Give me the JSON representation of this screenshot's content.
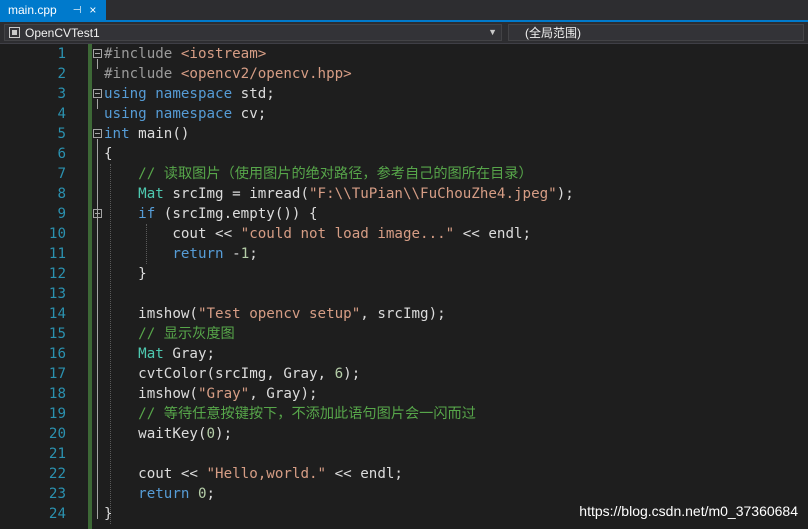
{
  "tab": {
    "label": "main.cpp",
    "pin": "⊣",
    "close": "×"
  },
  "navbar": {
    "project": "OpenCVTest1",
    "scope": "(全局范围)"
  },
  "code_lines": [
    {
      "n": "1",
      "segs": [
        [
          "pp",
          "#include "
        ],
        [
          "inc",
          "<iostream>"
        ]
      ]
    },
    {
      "n": "2",
      "segs": [
        [
          "pp",
          "#include "
        ],
        [
          "inc",
          "<opencv2/opencv.hpp>"
        ]
      ]
    },
    {
      "n": "3",
      "segs": [
        [
          "kw",
          "using namespace "
        ],
        [
          "plain",
          "std;"
        ]
      ]
    },
    {
      "n": "4",
      "segs": [
        [
          "kw",
          "using namespace "
        ],
        [
          "plain",
          "cv;"
        ]
      ]
    },
    {
      "n": "5",
      "segs": [
        [
          "kw",
          "int "
        ],
        [
          "plain",
          "main()"
        ]
      ]
    },
    {
      "n": "6",
      "segs": [
        [
          "plain",
          "{"
        ]
      ]
    },
    {
      "n": "7",
      "segs": [
        [
          "plain",
          "    "
        ],
        [
          "cm",
          "// 读取图片（使用图片的绝对路径，参考自己的图所在目录）"
        ]
      ]
    },
    {
      "n": "8",
      "segs": [
        [
          "plain",
          "    "
        ],
        [
          "ty",
          "Mat"
        ],
        [
          "plain",
          " srcImg = imread("
        ],
        [
          "str",
          "\"F:\\\\TuPian\\\\FuChouZhe4.jpeg\""
        ],
        [
          "plain",
          ");"
        ]
      ]
    },
    {
      "n": "9",
      "segs": [
        [
          "plain",
          "    "
        ],
        [
          "kw",
          "if"
        ],
        [
          "plain",
          " (srcImg.empty()) {"
        ]
      ]
    },
    {
      "n": "10",
      "segs": [
        [
          "plain",
          "        cout << "
        ],
        [
          "str",
          "\"could not load image...\""
        ],
        [
          "plain",
          " << endl;"
        ]
      ]
    },
    {
      "n": "11",
      "segs": [
        [
          "plain",
          "        "
        ],
        [
          "kw",
          "return"
        ],
        [
          "plain",
          " -"
        ],
        [
          "num",
          "1"
        ],
        [
          "plain",
          ";"
        ]
      ]
    },
    {
      "n": "12",
      "segs": [
        [
          "plain",
          "    }"
        ]
      ]
    },
    {
      "n": "13",
      "segs": [
        [
          "plain",
          ""
        ]
      ]
    },
    {
      "n": "14",
      "segs": [
        [
          "plain",
          "    imshow("
        ],
        [
          "str",
          "\"Test opencv setup\""
        ],
        [
          "plain",
          ", srcImg);"
        ]
      ]
    },
    {
      "n": "15",
      "segs": [
        [
          "plain",
          "    "
        ],
        [
          "cm",
          "// 显示灰度图"
        ]
      ]
    },
    {
      "n": "16",
      "segs": [
        [
          "plain",
          "    "
        ],
        [
          "ty",
          "Mat"
        ],
        [
          "plain",
          " Gray;"
        ]
      ]
    },
    {
      "n": "17",
      "segs": [
        [
          "plain",
          "    cvtColor(srcImg, Gray, "
        ],
        [
          "num",
          "6"
        ],
        [
          "plain",
          ");"
        ]
      ]
    },
    {
      "n": "18",
      "segs": [
        [
          "plain",
          "    imshow("
        ],
        [
          "str",
          "\"Gray\""
        ],
        [
          "plain",
          ", Gray);"
        ]
      ]
    },
    {
      "n": "19",
      "segs": [
        [
          "plain",
          "    "
        ],
        [
          "cm",
          "// 等待任意按键按下，不添加此语句图片会一闪而过"
        ]
      ]
    },
    {
      "n": "20",
      "segs": [
        [
          "plain",
          "    waitKey("
        ],
        [
          "num",
          "0"
        ],
        [
          "plain",
          ");"
        ]
      ]
    },
    {
      "n": "21",
      "segs": [
        [
          "plain",
          ""
        ]
      ]
    },
    {
      "n": "22",
      "segs": [
        [
          "plain",
          "    cout << "
        ],
        [
          "str",
          "\"Hello,world.\""
        ],
        [
          "plain",
          " << endl;"
        ]
      ]
    },
    {
      "n": "23",
      "segs": [
        [
          "plain",
          "    "
        ],
        [
          "kw",
          "return"
        ],
        [
          "plain",
          " "
        ],
        [
          "num",
          "0"
        ],
        [
          "plain",
          ";"
        ]
      ]
    },
    {
      "n": "24",
      "segs": [
        [
          "plain",
          "}"
        ]
      ]
    }
  ],
  "watermark": "https://blog.csdn.net/m0_37360684",
  "colors": {
    "keyword": "#569cd6",
    "string": "#d69d85",
    "comment": "#57a64a",
    "type": "#4ec9b0",
    "line_number": "#2b91af",
    "accent": "#007acc"
  }
}
